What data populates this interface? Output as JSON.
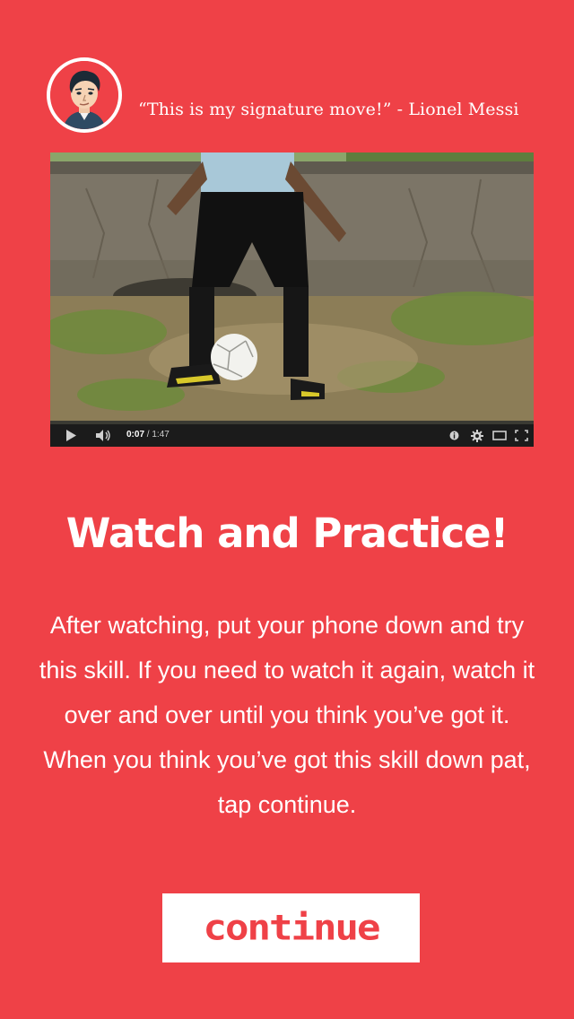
{
  "quote": {
    "text": "“This is my signature move!” - Lionel Messi",
    "avatar_icon": "cartoon-face-avatar"
  },
  "video": {
    "scene": "soccer-player-with-ball",
    "progress_fraction": 0.0794,
    "current_time": "0:07",
    "separator": " / ",
    "duration": "1:47",
    "controls": [
      "play-icon",
      "volume-icon",
      "info-icon",
      "gear-icon",
      "theater-mode-icon",
      "fullscreen-icon"
    ]
  },
  "main": {
    "heading": "Watch and Practice!",
    "body": "After watching, put your phone down and try this skill. If you need to watch it again, watch it over and over until you think you’ve got it. When you think you’ve got this skill down pat, tap continue."
  },
  "continue_button": {
    "label": "continue"
  },
  "colors": {
    "background": "#ef4147",
    "text": "#ffffff",
    "button_bg": "#ffffff",
    "button_text": "#ef4147",
    "progress_played": "#e62117",
    "player_bar": "#1b1b1b"
  }
}
